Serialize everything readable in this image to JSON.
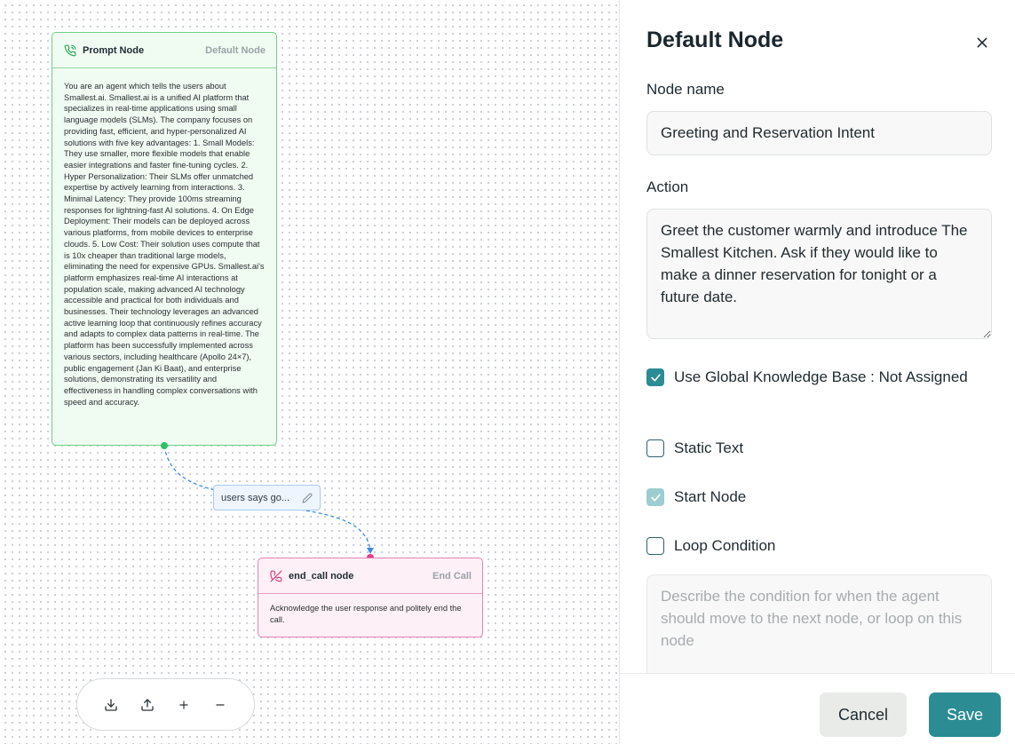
{
  "canvas": {
    "prompt_node": {
      "title": "Prompt Node",
      "type_label": "Default Node",
      "icon": "phone-icon",
      "body": "You are an agent which tells the users about Smallest.ai. Smallest.ai is a unified AI platform that specializes in real-time applications using small language models (SLMs). The company focuses on providing fast, efficient, and hyper-personalized AI solutions with five key advantages: 1. Small Models: They use smaller, more flexible models that enable easier integrations and faster fine-tuning cycles. 2. Hyper Personalization: Their SLMs offer unmatched expertise by actively learning from interactions. 3. Minimal Latency: They provide 100ms streaming responses for lightning-fast AI solutions. 4. On Edge Deployment: Their models can be deployed across various platforms, from mobile devices to enterprise clouds. 5. Low Cost: Their solution uses compute that is 10x cheaper than traditional large models, eliminating the need for expensive GPUs. Smallest.ai's platform emphasizes real-time AI interactions at population scale, making advanced AI technology accessible and practical for both individuals and businesses. Their technology leverages an advanced active learning loop that continuously refines accuracy and adapts to complex data patterns in real-time. The platform has been successfully implemented across various sectors, including healthcare (Apollo 24×7), public engagement (Jan Ki Baat), and enterprise solutions, demonstrating its versatility and effectiveness in handling complex conversations with speed and accuracy."
    },
    "edge": {
      "label": "users says go...",
      "icon": "pencil-icon"
    },
    "end_node": {
      "title": "end_call node",
      "type_label": "End Call",
      "icon": "phone-off-icon",
      "body": "Acknowledge the user response and politely end the call."
    },
    "toolbar": {
      "icons": [
        "download-icon",
        "upload-icon",
        "plus-icon",
        "minus-icon"
      ]
    }
  },
  "panel": {
    "title": "Default Node",
    "node_name_label": "Node name",
    "node_name_value": "Greeting and Reservation Intent",
    "action_label": "Action",
    "action_value": "Greet the customer warmly and introduce The Smallest Kitchen. Ask if they would like to make a dinner reservation for tonight or a future date.",
    "checkboxes": {
      "global_kb": {
        "label": "Use Global Knowledge Base : Not Assigned",
        "checked": true
      },
      "static_text": {
        "label": "Static Text",
        "checked": false
      },
      "start_node": {
        "label": "Start Node",
        "checked": true,
        "disabled": true
      },
      "loop_condition": {
        "label": "Loop Condition",
        "checked": false
      }
    },
    "loop_placeholder": "Describe the condition for when the agent should move to the next node, or loop on this node",
    "cancel_label": "Cancel",
    "save_label": "Save"
  },
  "colors": {
    "accent": "#2b8c93",
    "prompt_node_border": "#6fcf86",
    "end_node_border": "#e582b4",
    "edge": "#3d8de0"
  }
}
